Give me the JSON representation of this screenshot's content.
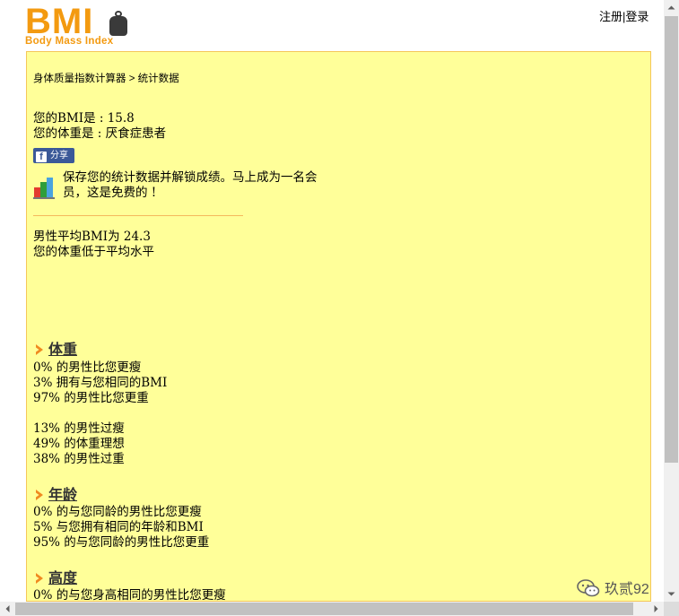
{
  "logo": {
    "big_text": "BMI",
    "sub_text": "Body Mass Index"
  },
  "toplinks": {
    "register": "注册",
    "separator": "|",
    "login": "登录"
  },
  "breadcrumb": {
    "home": "身体质量指数计算器",
    "separator": " > ",
    "current": "统计数据"
  },
  "result": {
    "bmi_line": "您的BMI是 : 15.8",
    "weight_line": "您的体重是 : 厌食症患者"
  },
  "share": {
    "icon_letter": "f",
    "label": "分享"
  },
  "promo": {
    "text": "保存您的统计数据并解锁成绩。马上成为一名会员，这是免费的 !"
  },
  "average": {
    "line1": "男性平均BMI为 24.3",
    "line2": "您的体重低于平均水平"
  },
  "sections": {
    "weight": {
      "title": "体重",
      "lines": [
        "0% 的男性比您更瘦",
        "3% 拥有与您相同的BMI",
        "97% 的男性比您更重"
      ],
      "lines2": [
        "13% 的男性过瘦",
        "49% 的体重理想",
        "38% 的男性过重"
      ]
    },
    "age": {
      "title": "年龄",
      "lines": [
        "0% 的与您同龄的男性比您更瘦",
        "5% 与您拥有相同的年龄和BMI",
        "95% 的与您同龄的男性比您更重"
      ]
    },
    "height": {
      "title": "高度",
      "lines": [
        "0% 的与您身高相同的男性比您更瘦"
      ]
    }
  },
  "watermark": {
    "text": "玖贰92"
  },
  "colors": {
    "accent": "#f39a10",
    "panel_bg": "#ffff99",
    "panel_border": "#f5c75a",
    "facebook": "#3b5998"
  }
}
